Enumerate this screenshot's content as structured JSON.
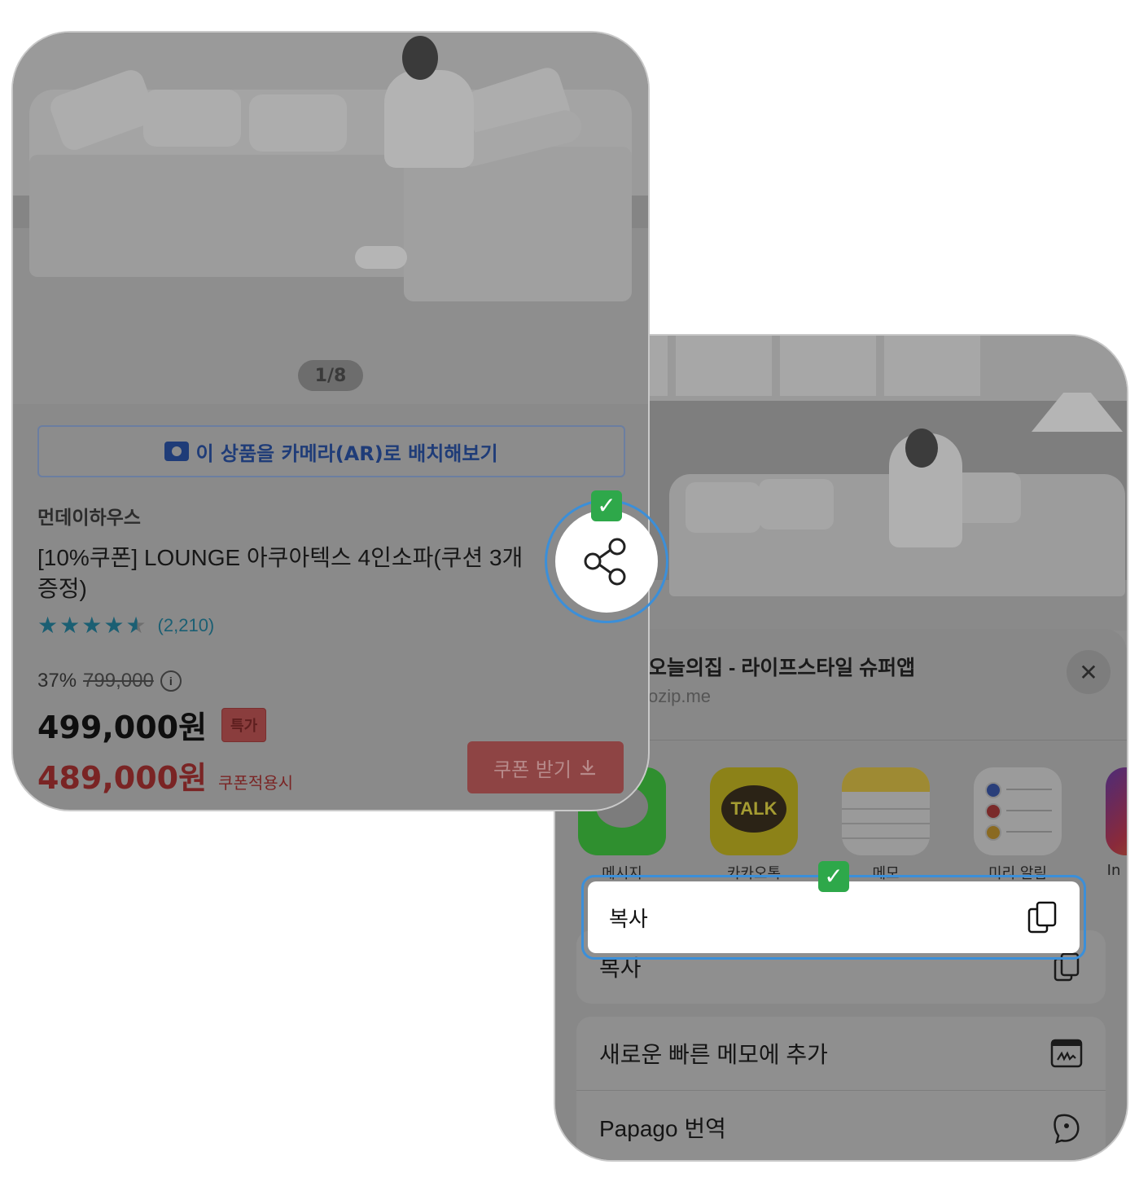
{
  "product": {
    "pager": "1/8",
    "ar_button": "이 상품을 카메라(AR)로 배치해보기",
    "brand": "먼데이하우스",
    "title": "[10%쿠폰] LOUNGE 아쿠아텍스 4인소파(쿠션 3개증정)",
    "rating_stars": 4.5,
    "review_count": "(2,210)",
    "discount_rate": "37%",
    "original_price": "799,000",
    "price": "499,000원",
    "special_badge": "특가",
    "coupon_price": "489,000원",
    "coupon_price_label": "쿠폰적용시",
    "coupon_button": "쿠폰 받기"
  },
  "share_sheet": {
    "title": "오늘의집 - 라이프스타일 슈퍼앱",
    "url": "ozip.me",
    "apps": [
      {
        "label": "메시지",
        "icon": "messages-icon"
      },
      {
        "label": "카카오톡",
        "icon": "kakaotalk-icon",
        "icon_text": "TALK"
      },
      {
        "label": "메모",
        "icon": "notes-icon"
      },
      {
        "label": "미리 알림",
        "icon": "reminders-icon"
      },
      {
        "label": "In",
        "icon": "instagram-icon"
      }
    ],
    "highlight_copy": "복사",
    "actions": [
      {
        "label": "복사",
        "icon": "copy-icon"
      },
      {
        "label": "새로운 빠른 메모에 추가",
        "icon": "quick-note-icon"
      },
      {
        "label": "Papago 번역",
        "icon": "papago-icon"
      }
    ]
  },
  "colors": {
    "highlight": "#3b8fd9",
    "check_badge": "#2ea84a"
  }
}
